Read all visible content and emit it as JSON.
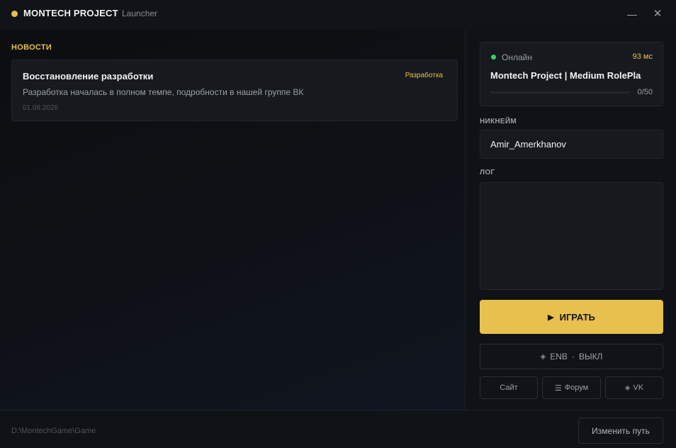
{
  "titlebar": {
    "app_name": "MONTECH PROJECT",
    "separator": "·",
    "subtitle": "Launcher",
    "minimize_icon": "minimize-icon",
    "close_icon": "close-icon",
    "close_glyph": "✕"
  },
  "news": {
    "heading": "НОВОСТИ",
    "items": [
      {
        "title": "Восстановление разработки",
        "tag": "Разработка",
        "text": "Разработка началась в полном темпе, подробности в нашей группе ВК",
        "date": "01.08.2026"
      }
    ]
  },
  "server": {
    "status": "Онлайн",
    "ping": "93 мс",
    "name": "Montech Project | Medium RolePla",
    "players": "0/50",
    "players_fraction": 0
  },
  "nickname": {
    "label": "НИКНЕЙМ",
    "value": "Amir_Amerkhanov"
  },
  "log": {
    "label": "ЛОГ"
  },
  "actions": {
    "play_icon": "▶",
    "play_label": "ИГРАТЬ",
    "enb_icon": "◈",
    "enb_label": "ENB",
    "enb_separator": "·",
    "enb_state": "ВЫКЛ",
    "site_label": "Сайт",
    "forum_icon": "☰",
    "forum_label": "Форум",
    "vk_icon": "◈",
    "vk_label": "VK"
  },
  "footer": {
    "path": "D:\\MontechGame\\Game",
    "change_path_label": "Изменить путь"
  },
  "colors": {
    "accent": "#e8c04e",
    "online": "#35d26a",
    "background": "#0f1216"
  }
}
